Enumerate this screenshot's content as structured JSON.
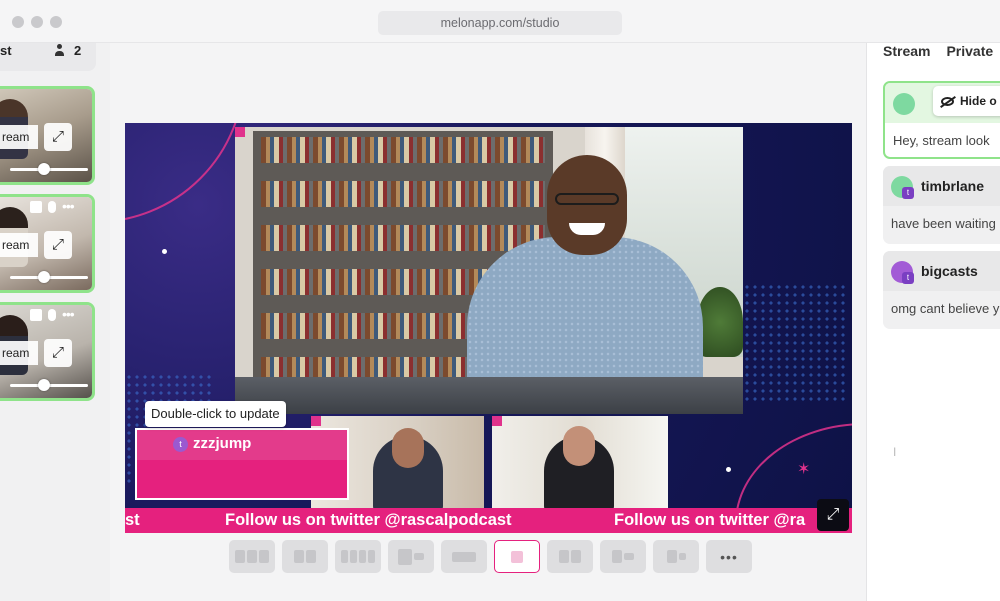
{
  "window": {
    "url": "melonapp.com/studio"
  },
  "left_rail": {
    "header_label": "st",
    "guest_count": "2",
    "tiles": [
      {
        "stream_label": "ream",
        "slider_value": 0.42
      },
      {
        "stream_label": "ream",
        "slider_value": 0.42
      },
      {
        "stream_label": "ream",
        "slider_value": 0.42
      }
    ]
  },
  "stage": {
    "ticker_text_1": "st",
    "ticker_text_2": "Follow us on twitter @rascalpodcast",
    "ticker_text_3": "Follow us on twitter @ra",
    "name_card": "zzzjump",
    "tooltip": "Double-click to update",
    "fullscreen_icon": "expand-icon"
  },
  "layouts": {
    "count": 10,
    "active_index": 5,
    "more_label": "•••"
  },
  "chat": {
    "tabs": [
      "Stream",
      "Private"
    ],
    "hide_label": "Hide o",
    "messages": [
      {
        "user": "",
        "text": "Hey, stream look",
        "highlighted": true
      },
      {
        "user": "timbrlane",
        "text": "have been waiting"
      },
      {
        "user": "bigcasts",
        "text": "omg cant believe y"
      }
    ]
  },
  "colors": {
    "accent_pink": "#e5217e",
    "highlight_green": "#8fe38a",
    "stage_navy": "#17185a"
  }
}
